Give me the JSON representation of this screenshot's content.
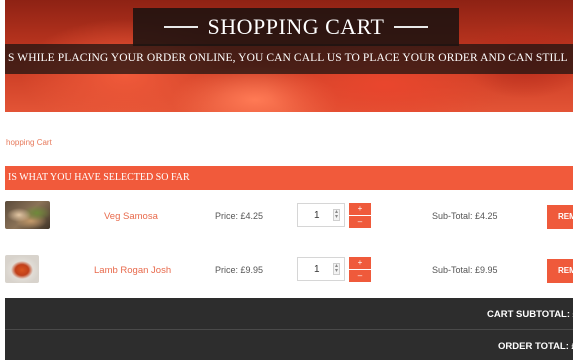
{
  "hero": {
    "title": "SHOPPING CART",
    "subtitle": "S WHILE PLACING YOUR ORDER ONLINE, YOU CAN CALL US TO PLACE YOUR ORDER AND CAN STILL"
  },
  "breadcrumb": "hopping Cart",
  "section": {
    "title": "IS WHAT YOU HAVE SELECTED SO FAR"
  },
  "items": [
    {
      "name": "Veg Samosa",
      "price": "Price: £4.25",
      "quantity": "1",
      "subtotal": "Sub-Total: £4.25",
      "remove_label": "REM"
    },
    {
      "name": "Lamb Rogan Josh",
      "price": "Price: £9.95",
      "quantity": "1",
      "subtotal": "Sub-Total: £9.95",
      "remove_label": "REM"
    }
  ],
  "qty_controls": {
    "increase": "+",
    "decrease": "–"
  },
  "totals": {
    "cart_subtotal_label": "CART SUBTOTAL: £",
    "order_total_label": "ORDER TOTAL: £"
  },
  "colors": {
    "accent": "#ef5a3b",
    "dark": "#2d2d2d",
    "link": "#e86a4c"
  }
}
